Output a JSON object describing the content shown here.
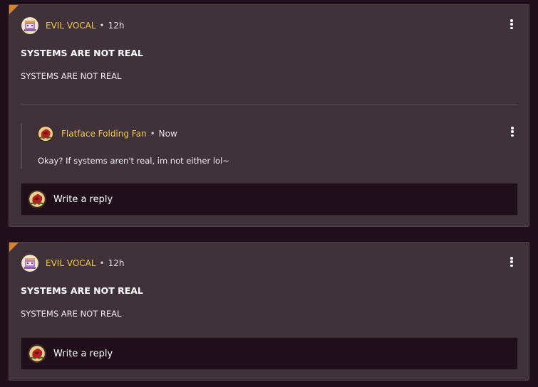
{
  "posts": [
    {
      "author": "EVIL VOCAL",
      "time": "12h",
      "title": "SYSTEMS ARE NOT REAL",
      "body": "SYSTEMS ARE NOT REAL",
      "avatar_icon": "pixel-character-icon",
      "replies": [
        {
          "author": "Flatface Folding Fan",
          "time": "Now",
          "body": "Okay? If systems aren't real, im not either lol~",
          "avatar_icon": "red-rose-icon"
        }
      ],
      "reply_placeholder": "Write a reply"
    },
    {
      "author": "EVIL VOCAL",
      "time": "12h",
      "title": "SYSTEMS ARE NOT REAL",
      "body": "SYSTEMS ARE NOT REAL",
      "avatar_icon": "pixel-character-icon",
      "replies": [],
      "reply_placeholder": "Write a reply"
    }
  ],
  "separator": "•",
  "colors": {
    "background": "#1e0f1b",
    "card": "#3f3339",
    "username": "#f6c945",
    "corner_accent": "#d9822b"
  }
}
